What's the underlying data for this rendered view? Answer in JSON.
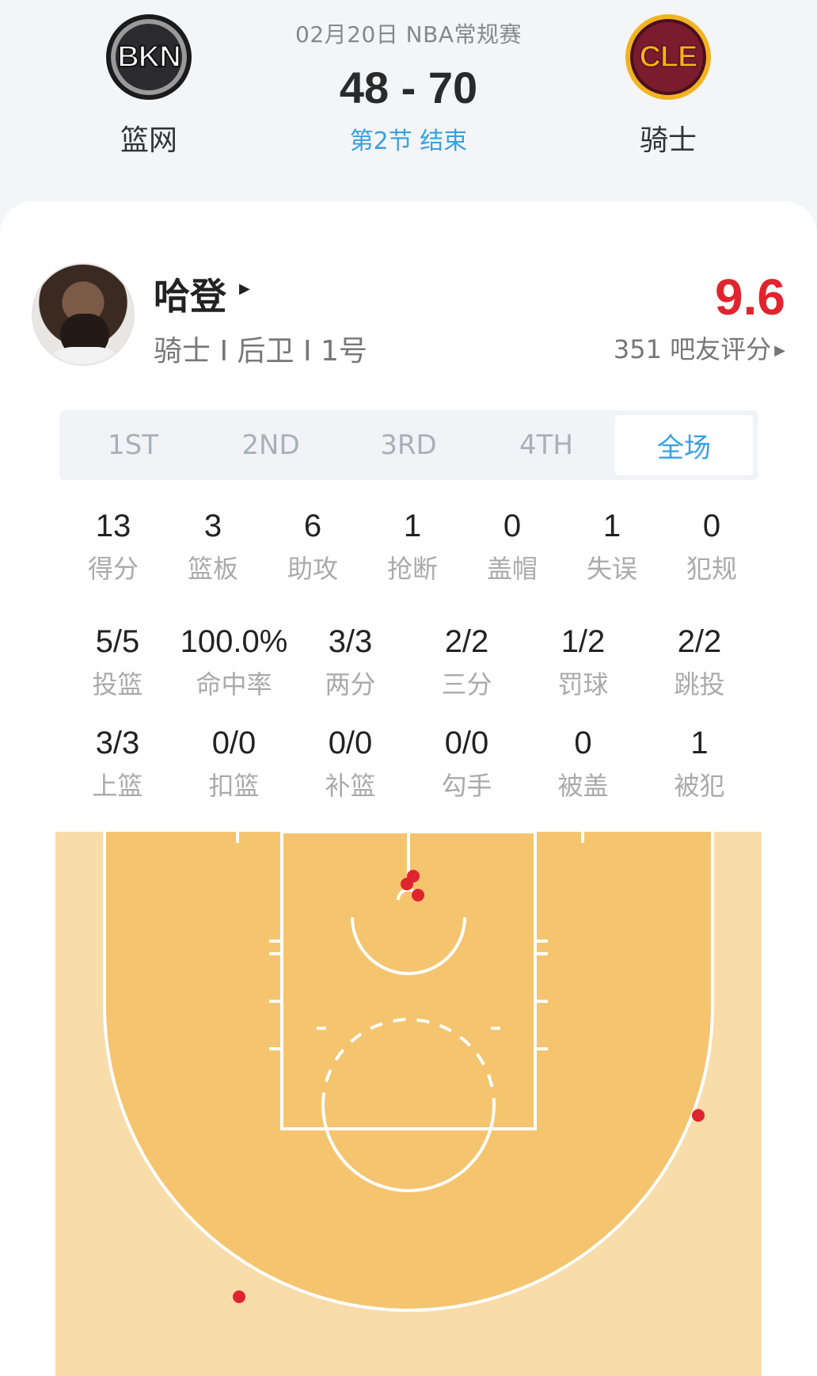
{
  "match": {
    "date_league": "02月20日 NBA常规赛",
    "score": "48 - 70",
    "period_status": "第2节 结束",
    "home": {
      "abbr": "BKN",
      "name": "篮网",
      "logo_colors": [
        "#2b2b2d",
        "#9a9a9a"
      ]
    },
    "away": {
      "abbr": "CLE",
      "name": "骑士",
      "logo_colors": [
        "#7a1c2e",
        "#f2b320"
      ]
    }
  },
  "player": {
    "name": "哈登",
    "meta": "骑士 I 后卫 I 1号",
    "rating": "9.6",
    "rating_count": "351 吧友评分",
    "rating_color": "#e0242f"
  },
  "tabs": [
    {
      "label": "1ST",
      "active": false
    },
    {
      "label": "2ND",
      "active": false
    },
    {
      "label": "3RD",
      "active": false
    },
    {
      "label": "4TH",
      "active": false
    },
    {
      "label": "全场",
      "active": true
    }
  ],
  "basic_stats": [
    {
      "value": "13",
      "label": "得分"
    },
    {
      "value": "3",
      "label": "篮板"
    },
    {
      "value": "6",
      "label": "助攻"
    },
    {
      "value": "1",
      "label": "抢断"
    },
    {
      "value": "0",
      "label": "盖帽"
    },
    {
      "value": "1",
      "label": "失误"
    },
    {
      "value": "0",
      "label": "犯规"
    }
  ],
  "shooting_stats": [
    {
      "value": "5/5",
      "label": "投篮"
    },
    {
      "value": "100.0%",
      "label": "命中率"
    },
    {
      "value": "3/3",
      "label": "两分"
    },
    {
      "value": "2/2",
      "label": "三分"
    },
    {
      "value": "1/2",
      "label": "罚球"
    },
    {
      "value": "2/2",
      "label": "跳投"
    }
  ],
  "shot_type_stats": [
    {
      "value": "3/3",
      "label": "上篮"
    },
    {
      "value": "0/0",
      "label": "扣篮"
    },
    {
      "value": "0/0",
      "label": "补篮"
    },
    {
      "value": "0/0",
      "label": "勾手"
    },
    {
      "value": "0",
      "label": "被盖"
    },
    {
      "value": "1",
      "label": "被犯"
    }
  ],
  "colors": {
    "accent": "#3aa0e0",
    "court_paint": "#f5c46e",
    "court_outer": "#f8dcaa",
    "shot_made": "#e0242f"
  },
  "shot_chart": {
    "made_shots": 5
  }
}
